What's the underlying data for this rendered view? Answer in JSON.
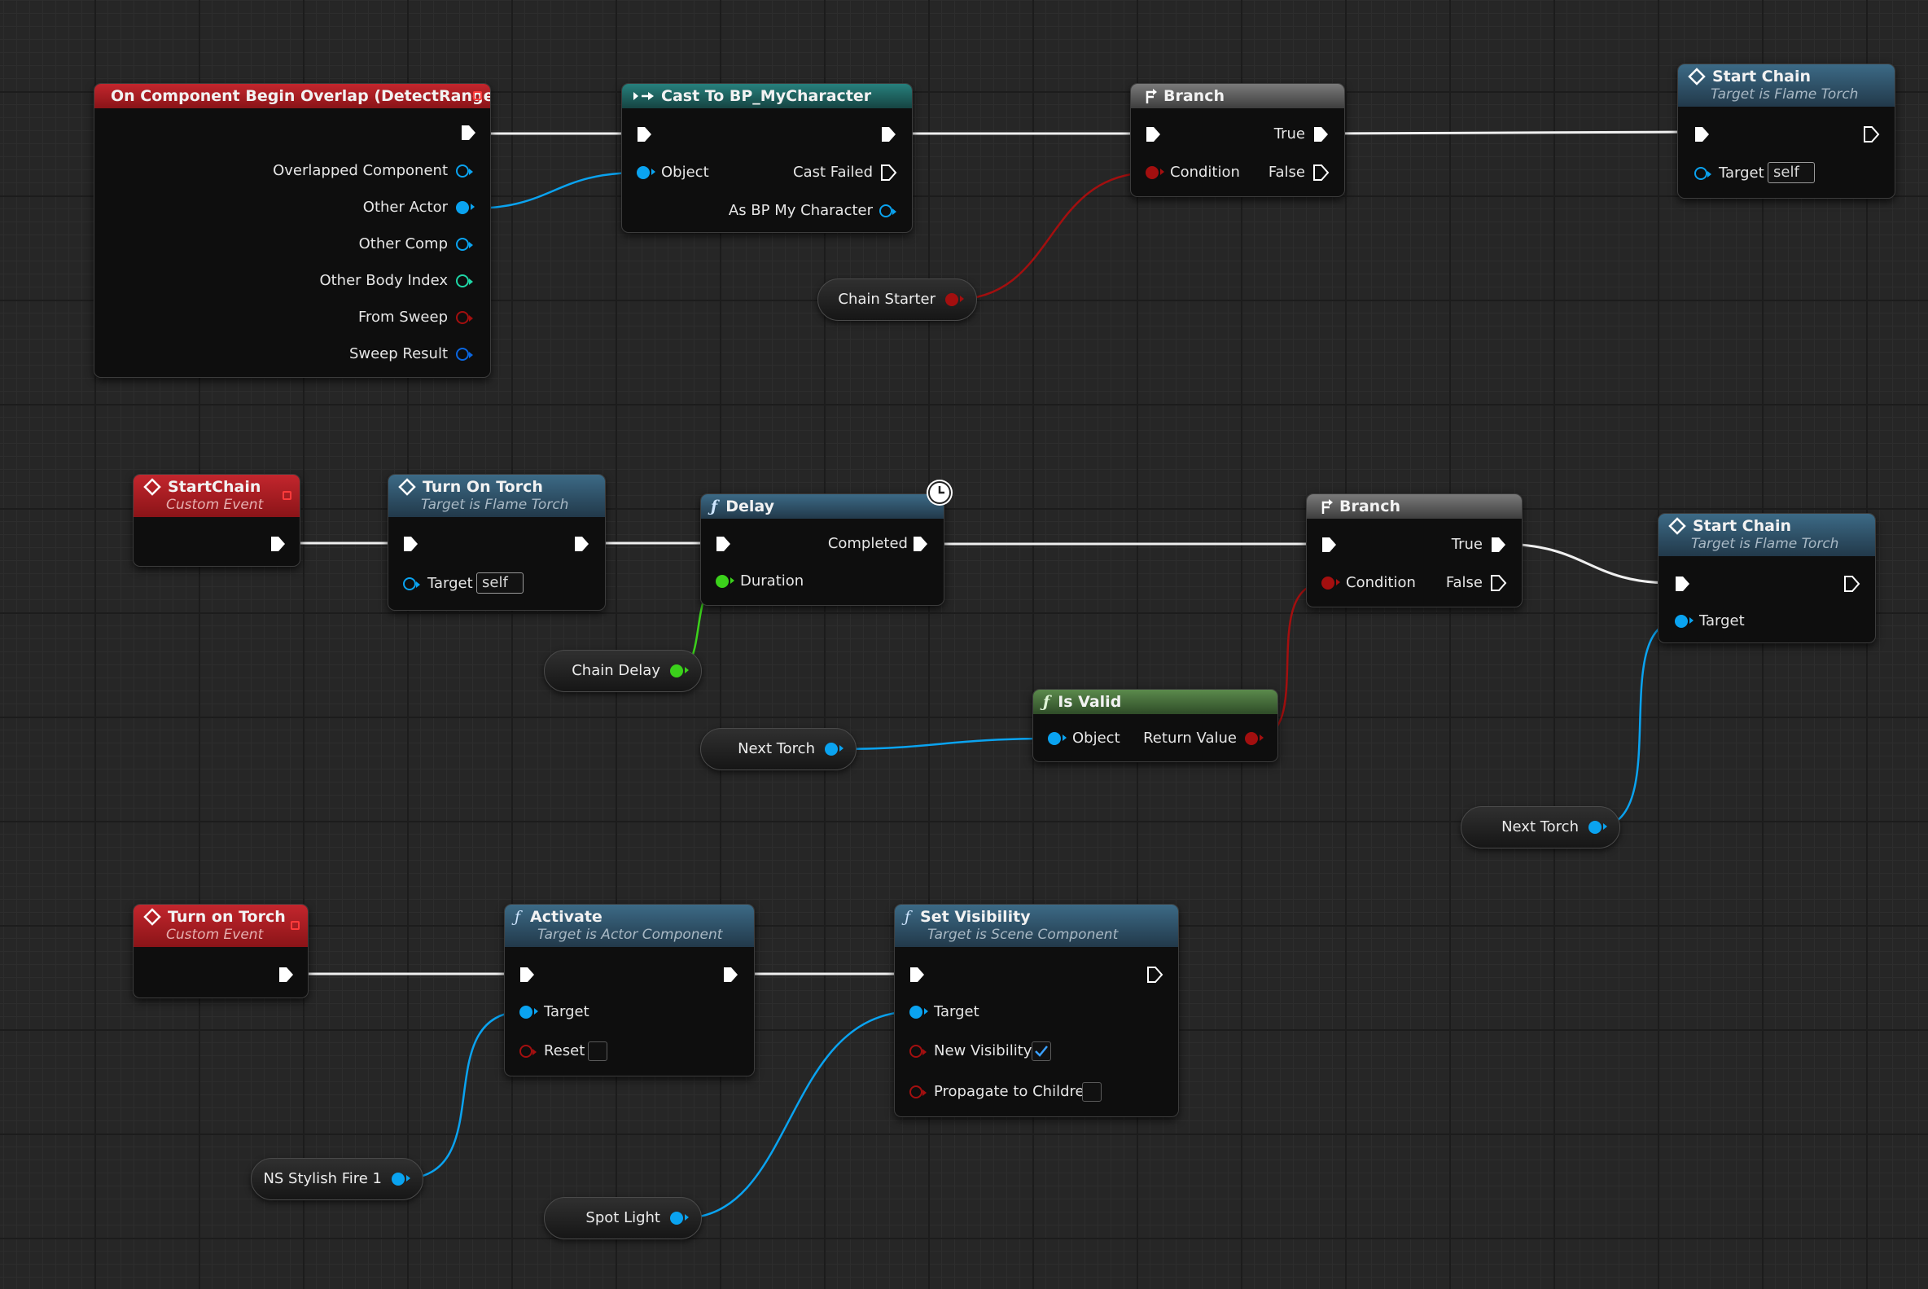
{
  "colors": {
    "exec": "#ffffff",
    "object": "#0aa3f0",
    "bool": "#a30f0f",
    "float": "#3bd11b",
    "int": "#1fd6a6",
    "struct": "#0a66e0"
  },
  "overlap_event": {
    "title": "On Component Begin Overlap (DetectRange)",
    "pins": [
      "Overlapped Component",
      "Other Actor",
      "Other Comp",
      "Other Body Index",
      "From Sweep",
      "Sweep Result"
    ]
  },
  "cast_node": {
    "title": "Cast To BP_MyCharacter",
    "object": "Object",
    "cast_failed": "Cast Failed",
    "as_char": "As BP My Character"
  },
  "branch1": {
    "title": "Branch",
    "condition": "Condition",
    "true": "True",
    "false": "False"
  },
  "start_chain1": {
    "title": "Start Chain",
    "subtitle": "Target is Flame Torch",
    "target": "Target",
    "target_value": "self"
  },
  "var_chain_starter": "Chain Starter",
  "startchain_event": {
    "title": "StartChain",
    "subtitle": "Custom Event"
  },
  "turn_on_torch_call": {
    "title": "Turn On Torch",
    "subtitle": "Target is Flame Torch",
    "target": "Target",
    "target_value": "self"
  },
  "delay": {
    "title": "Delay",
    "completed": "Completed",
    "duration": "Duration"
  },
  "var_chain_delay": "Chain Delay",
  "branch2": {
    "title": "Branch",
    "condition": "Condition",
    "true": "True",
    "false": "False"
  },
  "is_valid": {
    "title": "Is Valid",
    "object": "Object",
    "return": "Return Value"
  },
  "var_next_torch_a": "Next Torch",
  "start_chain2": {
    "title": "Start Chain",
    "subtitle": "Target is Flame Torch",
    "target": "Target"
  },
  "var_next_torch_b": "Next Torch",
  "turnon_event": {
    "title": "Turn on Torch",
    "subtitle": "Custom Event"
  },
  "activate": {
    "title": "Activate",
    "subtitle": "Target is Actor Component",
    "target": "Target",
    "reset": "Reset",
    "reset_checked": false
  },
  "set_visibility": {
    "title": "Set Visibility",
    "subtitle": "Target is Scene Component",
    "target": "Target",
    "new_visibility": "New Visibility",
    "new_visibility_checked": true,
    "propagate": "Propagate to Children",
    "propagate_checked": false
  },
  "var_ns_fire": "NS Stylish Fire 1",
  "var_spot_light": "Spot Light"
}
